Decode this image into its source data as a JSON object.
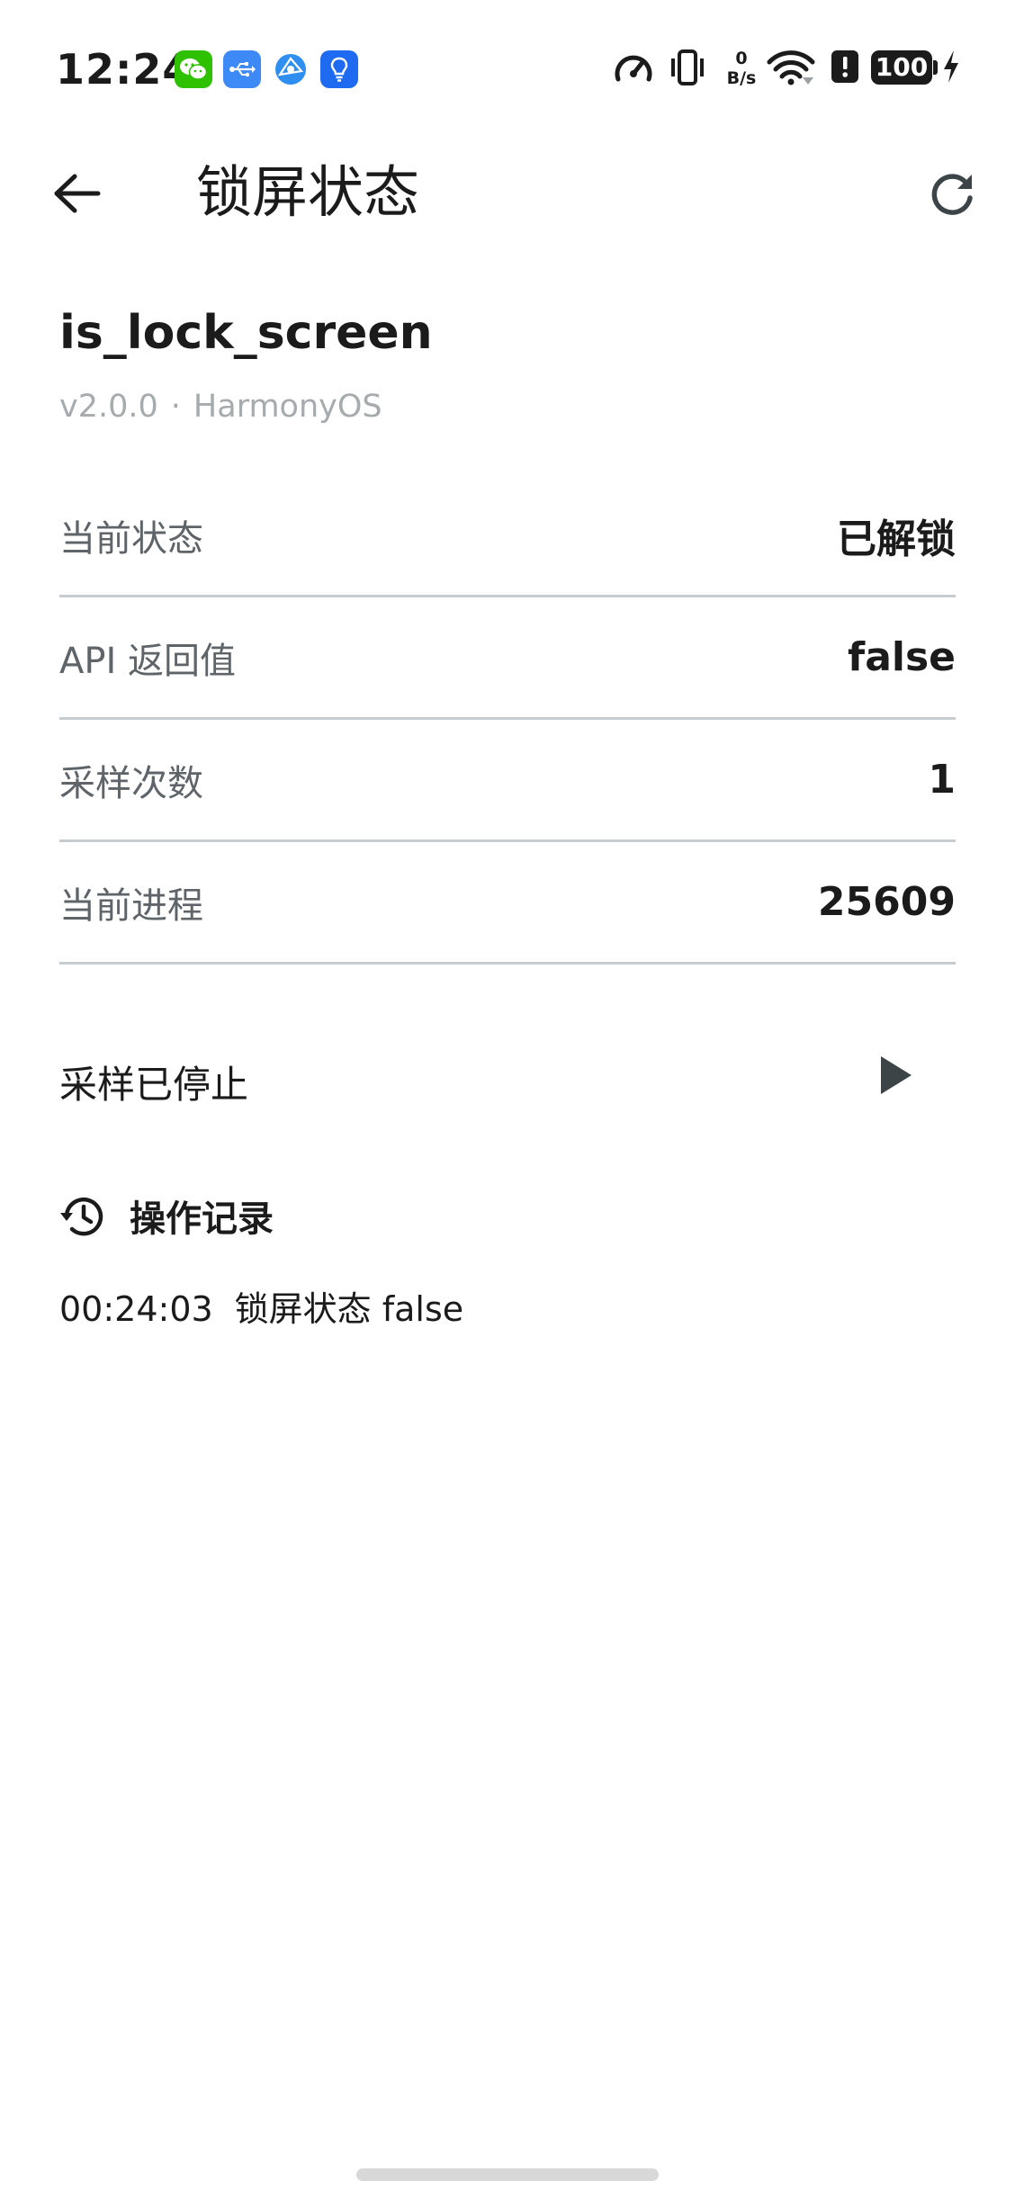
{
  "status_bar": {
    "time": "12:24",
    "notification_icons": [
      "wechat-icon",
      "usb-icon",
      "browser-icon",
      "tips-icon"
    ],
    "net_speed_value": "0",
    "net_speed_unit": "B/s",
    "battery_level": "100",
    "charging": true
  },
  "app_bar": {
    "title": "锁屏状态",
    "back_icon": "arrow-left-icon",
    "refresh_icon": "refresh-icon"
  },
  "header": {
    "api_name": "is_lock_screen",
    "version": "v2.0.0",
    "separator": "·",
    "platform": "HarmonyOS"
  },
  "info_rows": [
    {
      "label": "当前状态",
      "value": "已解锁"
    },
    {
      "label": "API 返回值",
      "value": "false"
    },
    {
      "label": "采样次数",
      "value": "1"
    },
    {
      "label": "当前进程",
      "value": "25609"
    }
  ],
  "sampling": {
    "status_text": "采样已停止",
    "play_icon": "play-icon"
  },
  "history": {
    "title": "操作记录",
    "icon": "history-icon",
    "entries": [
      {
        "time": "00:24:03",
        "text": "锁屏状态 false"
      }
    ]
  },
  "colors": {
    "text_primary": "#1b1b1b",
    "text_secondary": "#5e6468",
    "text_muted": "#a6abad",
    "divider": "#c7cdcf",
    "icon_gray": "#3c4448"
  }
}
